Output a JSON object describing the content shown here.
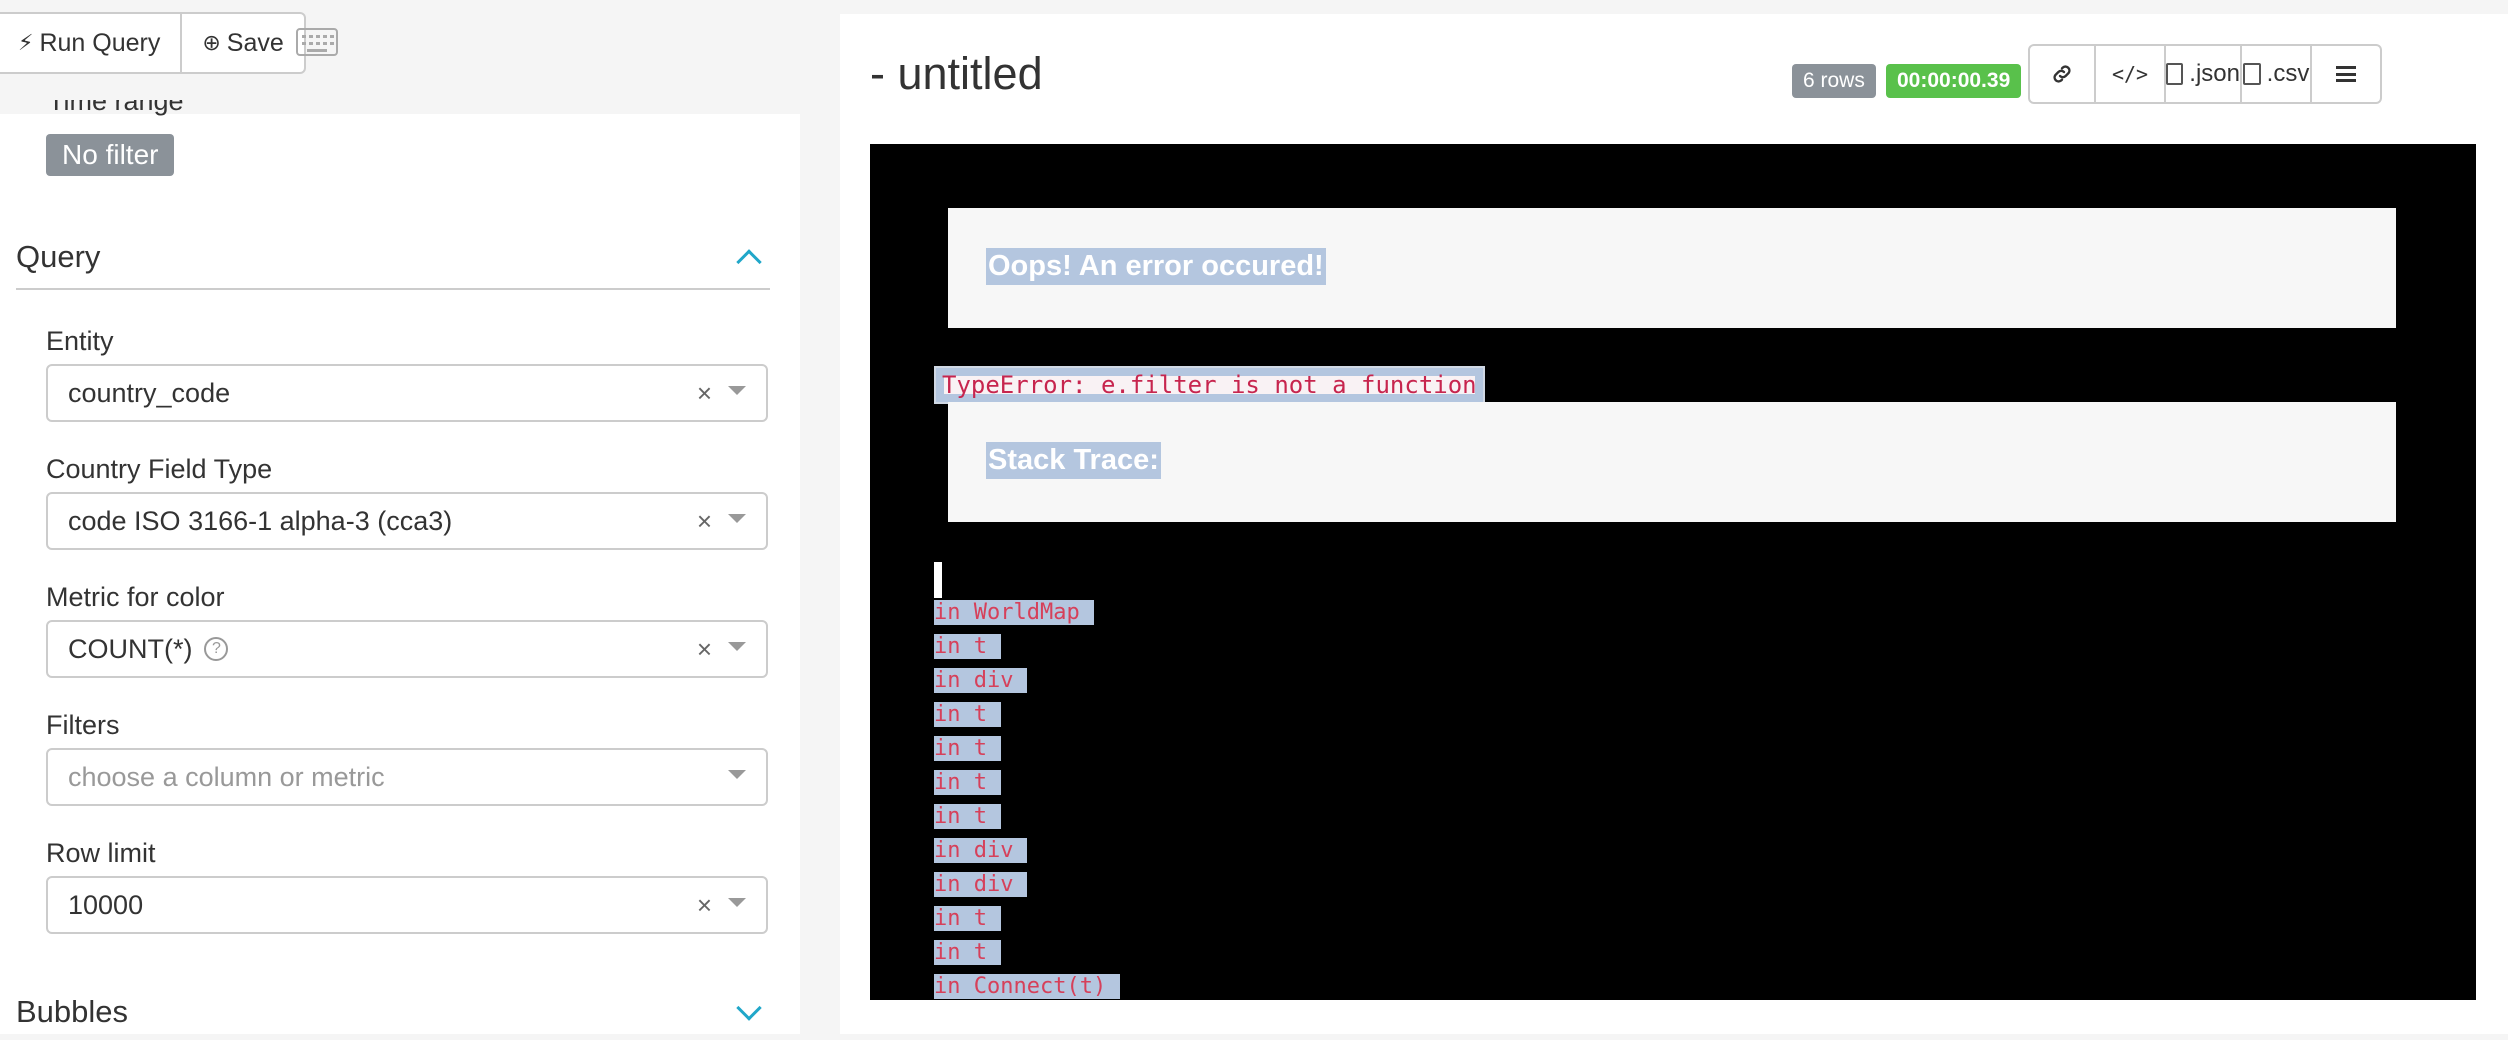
{
  "toolbar": {
    "run_query_label": "Run Query",
    "save_label": "Save"
  },
  "time_range": {
    "label": "Time range",
    "filter_label": "No filter"
  },
  "query_section": {
    "title": "Query",
    "fields": {
      "entity": {
        "label": "Entity",
        "value": "country_code"
      },
      "country_field_type": {
        "label": "Country Field Type",
        "value": "code ISO 3166-1 alpha-3 (cca3)"
      },
      "metric": {
        "label": "Metric for color",
        "value": "COUNT(*)"
      },
      "filters": {
        "label": "Filters",
        "placeholder": "choose a column or metric"
      },
      "row_limit": {
        "label": "Row limit",
        "value": "10000"
      }
    }
  },
  "bubbles_section": {
    "title": "Bubbles"
  },
  "chart": {
    "title": "- untitled",
    "rows_badge": "6 rows",
    "time_badge": "00:00:00.39",
    "actions": {
      "json_label": ".json",
      "csv_label": ".csv"
    }
  },
  "error": {
    "heading": "Oops! An error occured!",
    "message": "TypeError: e.filter is not a function",
    "stack_heading": "Stack Trace:",
    "stack": [
      "in WorldMap",
      "in t",
      "in div",
      "in t",
      "in t",
      "in t",
      "in t",
      "in div",
      "in div",
      "in t",
      "in t",
      "in Connect(t)"
    ]
  },
  "colors": {
    "accent": "#20a7c9",
    "success": "#59c14b",
    "muted_badge": "#8b9299",
    "error_text": "#c7254e",
    "selection": "#b4c6df"
  }
}
